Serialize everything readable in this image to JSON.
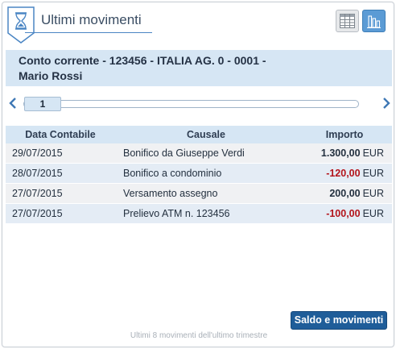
{
  "header": {
    "title": "Ultimi movimenti",
    "icon": "hourglass-icon",
    "view_buttons": [
      {
        "name": "table-view",
        "icon": "table-grid-icon",
        "active": false
      },
      {
        "name": "chart-view",
        "icon": "bar-chart-icon",
        "active": true
      }
    ]
  },
  "account": {
    "line1": "Conto corrente - 123456 - ITALIA AG. 0 - 0001 -",
    "line2": "Mario Rossi"
  },
  "pager": {
    "current_page": "1",
    "prev_icon": "chevron-left-icon",
    "next_icon": "chevron-right-icon"
  },
  "table": {
    "columns": [
      "Data Contabile",
      "Causale",
      "Importo"
    ],
    "rows": [
      {
        "date": "29/07/2015",
        "causale": "Bonifico da Giuseppe Verdi",
        "amount": "1.300,00",
        "currency": "EUR",
        "negative": false
      },
      {
        "date": "28/07/2015",
        "causale": "Bonifico a condominio",
        "amount": "-120,00",
        "currency": "EUR",
        "negative": true
      },
      {
        "date": "27/07/2015",
        "causale": "Versamento assegno",
        "amount": "200,00",
        "currency": "EUR",
        "negative": false
      },
      {
        "date": "27/07/2015",
        "causale": "Prelievo ATM n. 123456",
        "amount": "-100,00",
        "currency": "EUR",
        "negative": true
      }
    ]
  },
  "footer": {
    "button_label": "Saldo e movimenti",
    "note": "Ultimi 8 movimenti dell'ultimo trimestre"
  },
  "colors": {
    "accent": "#1f5d99",
    "header_band": "#d6e6f4",
    "negative": "#b3141b"
  }
}
